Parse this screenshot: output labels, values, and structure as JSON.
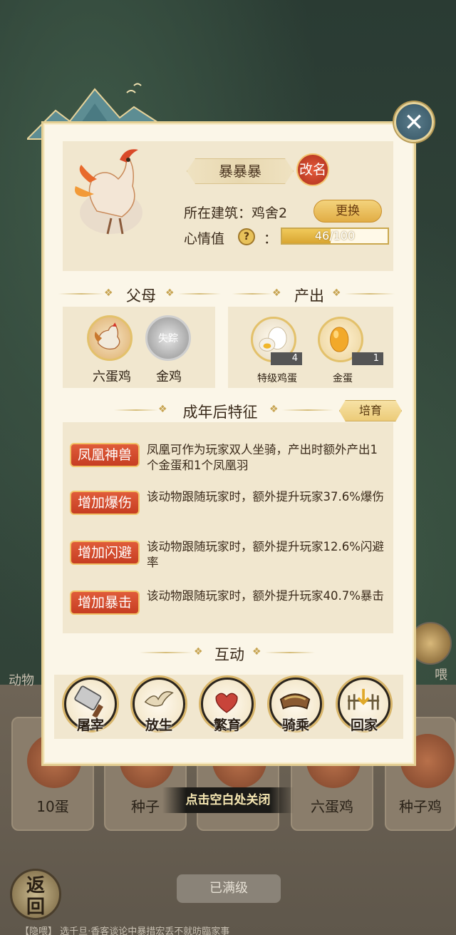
{
  "background": {
    "side_label": "动物",
    "feed_label": "喂",
    "cards": [
      "10蛋",
      "种子",
      "六蛋鸡",
      "种子鸡"
    ],
    "full_level": "已满级",
    "return_label": "返回",
    "ticker": "【隐喂】 选千旦·香客谈论中暴措宏丢不就昉臨家事"
  },
  "close_icon": "close-x-icon",
  "animal": {
    "name": "暴暴暴",
    "rename_label": "改名",
    "building_label": "所在建筑：鸡舍2",
    "change_label": "更换",
    "mood_label": "心情值",
    "mood_colon": "：",
    "mood_text": "46/100",
    "mood_value": 0.46
  },
  "sections": {
    "parents": "父母",
    "output": "产出",
    "traits": "成年后特征",
    "cultivate": "培育",
    "interact": "互动"
  },
  "parents": [
    {
      "name": "六蛋鸡",
      "tag": ""
    },
    {
      "name": "金鸡",
      "tag": "失踪"
    }
  ],
  "outputs": [
    {
      "name": "特级鸡蛋",
      "count": "4"
    },
    {
      "name": "金蛋",
      "count": "1"
    }
  ],
  "traits": [
    {
      "badge": "凤凰神兽",
      "desc": "凤凰可作为玩家双人坐骑，产出时额外产出1个金蛋和1个凤凰羽"
    },
    {
      "badge": "增加爆伤",
      "desc": "该动物跟随玩家时，额外提升玩家37.6%爆伤"
    },
    {
      "badge": "增加闪避",
      "desc": "该动物跟随玩家时，额外提升玩家12.6%闪避率"
    },
    {
      "badge": "增加暴击",
      "desc": "该动物跟随玩家时，额外提升玩家40.7%暴击"
    }
  ],
  "actions": [
    {
      "label": "屠宰",
      "icon": "cleaver-icon"
    },
    {
      "label": "放生",
      "icon": "bird-release-icon"
    },
    {
      "label": "繁育",
      "icon": "hearts-icon"
    },
    {
      "label": "骑乘",
      "icon": "saddle-icon"
    },
    {
      "label": "回家",
      "icon": "home-fence-icon"
    }
  ],
  "close_hint": "点击空白处关闭"
}
